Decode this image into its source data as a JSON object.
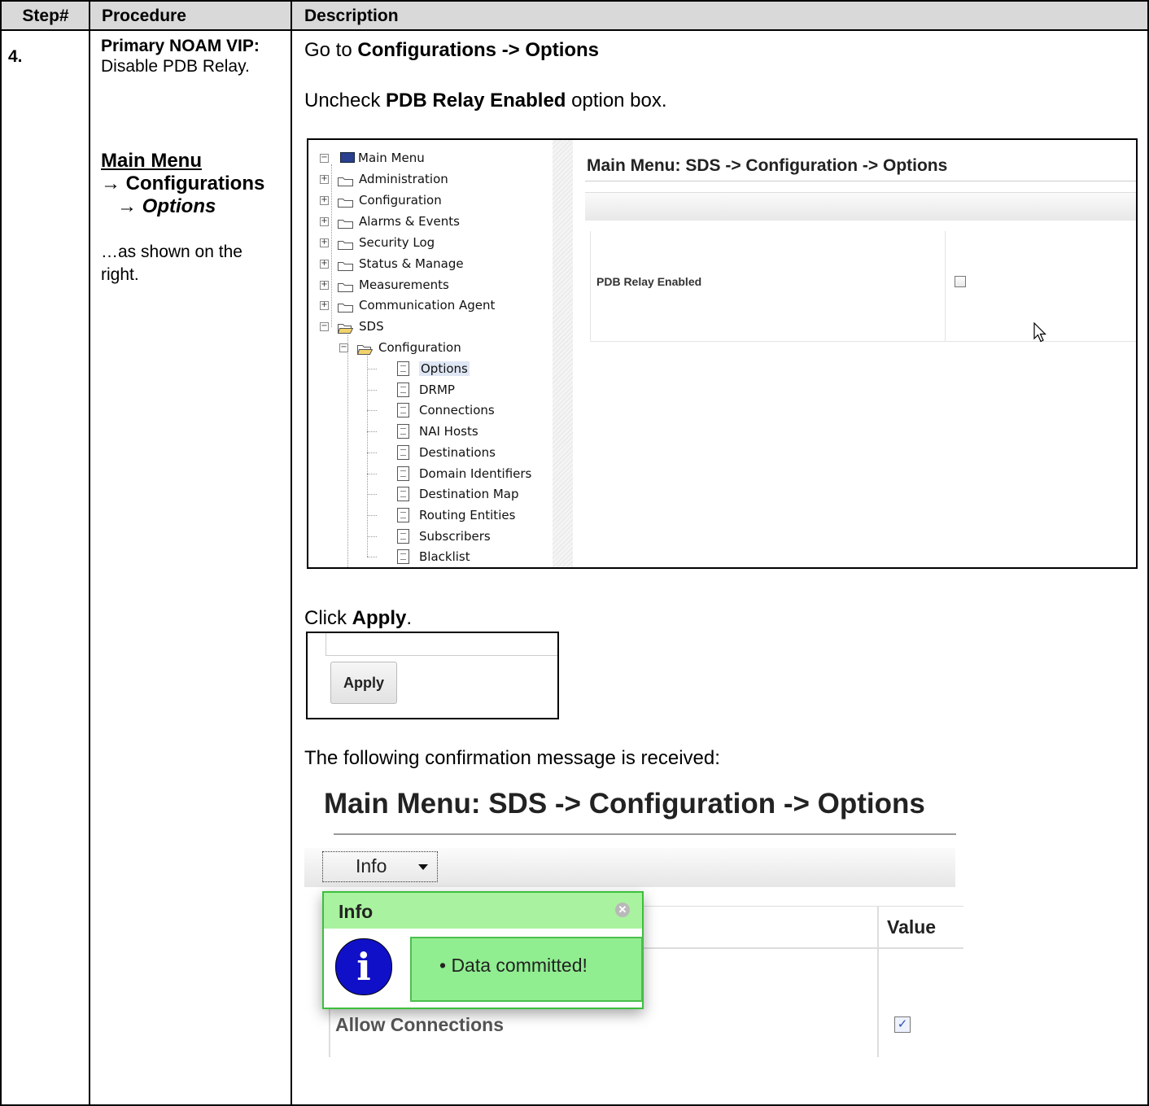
{
  "table": {
    "headers": {
      "step": "Step#",
      "procedure": "Procedure",
      "description": "Description"
    },
    "step_number": "4.",
    "procedure": {
      "title_bold": "Primary NOAM VIP:",
      "title_rest": "Disable PDB Relay.",
      "menu_path": "Main Menu",
      "menu_level1": "Configurations",
      "menu_level2": "Options",
      "arrow": "→",
      "note": "…as shown on the right."
    },
    "description": {
      "go_to_prefix": "Go to ",
      "go_to_target": "Configurations -> Options",
      "uncheck_prefix": "Uncheck ",
      "uncheck_target": "PDB Relay Enabled",
      "uncheck_suffix": " option box.",
      "click_prefix": "Click ",
      "click_target": "Apply",
      "click_suffix": ".",
      "confirmation_text": "The following confirmation message is received:"
    }
  },
  "screenshot1": {
    "tree": {
      "root": "Main Menu",
      "items": [
        "Administration",
        "Configuration",
        "Alarms & Events",
        "Security Log",
        "Status & Manage",
        "Measurements",
        "Communication Agent",
        "SDS"
      ],
      "sds_child": "Configuration",
      "config_children": [
        "Options",
        "DRMP",
        "Connections",
        "NAI Hosts",
        "Destinations",
        "Domain Identifiers",
        "Destination Map",
        "Routing Entities",
        "Subscribers",
        "Blacklist"
      ]
    },
    "panel_title": "Main Menu: SDS -> Configuration -> Options",
    "option_label": "PDB Relay Enabled",
    "option_checked": false
  },
  "screenshot2": {
    "button_label": "Apply"
  },
  "screenshot3": {
    "title": "Main Menu: SDS -> Configuration -> Options",
    "info_dropdown": "Info",
    "popup_title": "Info",
    "popup_message": "• Data committed!",
    "value_header": "Value",
    "row_label": "Allow Connections",
    "row_checked": true
  },
  "colors": {
    "header_bg": "#d9d9d9",
    "info_green": "#a8f0a0",
    "message_green": "#90ee90",
    "info_icon_blue": "#1010c8"
  }
}
